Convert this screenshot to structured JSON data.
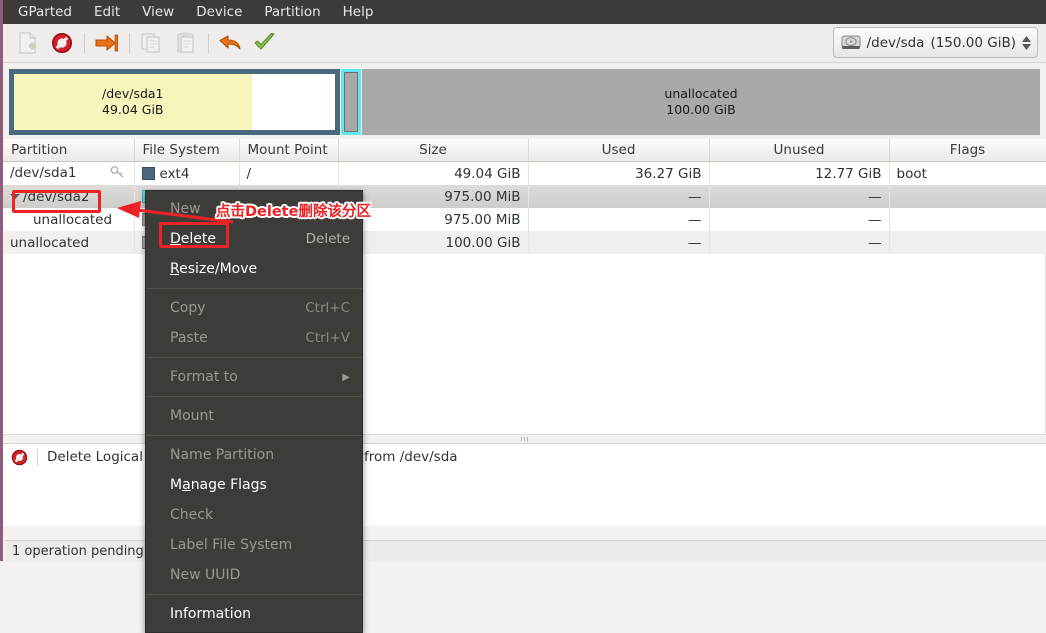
{
  "window": {
    "menubar": [
      {
        "label": "GParted"
      },
      {
        "label": "Edit"
      },
      {
        "label": "View"
      },
      {
        "label": "Device"
      },
      {
        "label": "Partition"
      },
      {
        "label": "Help"
      }
    ],
    "toolbar": {
      "buttons": [
        {
          "name": "new-partition-button",
          "icon": "new-document-icon",
          "enabled": false
        },
        {
          "name": "delete-partition-button",
          "icon": "delete-prohibition-icon",
          "enabled": true
        },
        {
          "name": "resize-move-button",
          "icon": "resize-arrow-icon",
          "enabled": true
        },
        {
          "name": "copy-button",
          "icon": "copy-icon",
          "enabled": false
        },
        {
          "name": "paste-button",
          "icon": "paste-icon",
          "enabled": false
        },
        {
          "name": "undo-button",
          "icon": "undo-arrow-icon",
          "enabled": true
        },
        {
          "name": "apply-button",
          "icon": "apply-check-icon",
          "enabled": true
        }
      ],
      "device_selector": {
        "icon": "hard-disk-icon",
        "device": "/dev/sda",
        "size": "(150.00 GiB)"
      }
    }
  },
  "disk_graphic": {
    "partitions": [
      {
        "name": "/dev/sda1",
        "size": "49.04 GiB",
        "fill_percent": 74,
        "color": "#f7f5bc"
      },
      {
        "name": "",
        "size": "",
        "selected": true,
        "color": "#5fe8ef"
      },
      {
        "name": "unallocated",
        "size": "100.00 GiB",
        "color": "#a9a9a9"
      }
    ]
  },
  "table": {
    "columns": [
      "Partition",
      "File System",
      "Mount Point",
      "Size",
      "Used",
      "Unused",
      "Flags"
    ],
    "rows": [
      {
        "partition": "/dev/sda1",
        "filesystem": "ext4",
        "fs_color": "#4a6880",
        "mount_point": "/",
        "size": "49.04 GiB",
        "used": "36.27 GiB",
        "unused": "12.77 GiB",
        "flags": "boot",
        "has_key_icon": true,
        "selected": false,
        "indent": false,
        "expander": ""
      },
      {
        "partition": "/dev/sda2",
        "filesystem": "",
        "fs_color": "#5fe8ef",
        "mount_point": "",
        "size": "975.00 MiB",
        "used": "—",
        "unused": "—",
        "flags": "",
        "has_key_icon": false,
        "selected": true,
        "indent": false,
        "expander": "open"
      },
      {
        "partition": "unallocated",
        "filesystem": "",
        "fs_color": "#a9a9a9",
        "mount_point": "",
        "size": "975.00 MiB",
        "used": "—",
        "unused": "—",
        "flags": "",
        "has_key_icon": false,
        "selected": false,
        "indent": true,
        "expander": ""
      },
      {
        "partition": "unallocated",
        "filesystem": "",
        "fs_color": "#a9a9a9",
        "mount_point": "",
        "size": "100.00 GiB",
        "used": "—",
        "unused": "—",
        "flags": "",
        "has_key_icon": false,
        "selected": false,
        "indent": false,
        "expander": ""
      }
    ]
  },
  "context_menu": {
    "items": [
      {
        "label": "New",
        "accel": "",
        "enabled": false,
        "underline": "",
        "separator_after": false
      },
      {
        "label": "Delete",
        "accel": "Delete",
        "enabled": true,
        "underline": "D",
        "separator_after": false
      },
      {
        "label": "Resize/Move",
        "accel": "",
        "enabled": true,
        "underline": "R",
        "separator_after": true
      },
      {
        "label": "Copy",
        "accel": "Ctrl+C",
        "enabled": false,
        "underline": "",
        "separator_after": false
      },
      {
        "label": "Paste",
        "accel": "Ctrl+V",
        "enabled": false,
        "underline": "",
        "separator_after": true
      },
      {
        "label": "Format to",
        "accel": "",
        "enabled": false,
        "underline": "",
        "submenu": true,
        "separator_after": true
      },
      {
        "label": "Mount",
        "accel": "",
        "enabled": false,
        "underline": "",
        "separator_after": true
      },
      {
        "label": "Name Partition",
        "accel": "",
        "enabled": false,
        "underline": "",
        "separator_after": false
      },
      {
        "label": "Manage Flags",
        "accel": "",
        "enabled": true,
        "underline": "a",
        "separator_after": false
      },
      {
        "label": "Check",
        "accel": "",
        "enabled": false,
        "underline": "",
        "separator_after": false
      },
      {
        "label": "Label File System",
        "accel": "",
        "enabled": false,
        "underline": "",
        "separator_after": false
      },
      {
        "label": "New UUID",
        "accel": "",
        "enabled": false,
        "underline": "",
        "separator_after": true
      },
      {
        "label": "Information",
        "accel": "",
        "enabled": true,
        "underline": "",
        "separator_after": false
      }
    ]
  },
  "pending_operations": {
    "icon": "delete-prohibition-icon",
    "text_start": "Delete Logical Pa",
    "text_end": "from /dev/sda"
  },
  "statusbar": {
    "text": "1 operation pending"
  },
  "annotation": {
    "text": "点击Delete删除该分区",
    "color": "#ec2227",
    "highlight_targets": [
      "/dev/sda2",
      "Delete"
    ]
  }
}
